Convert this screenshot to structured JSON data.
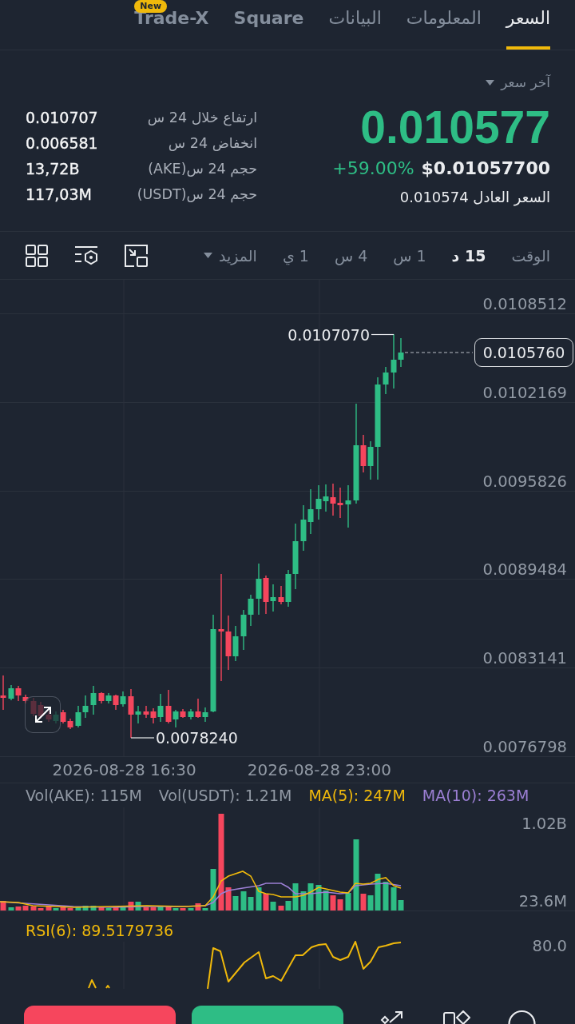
{
  "tabs": [
    {
      "label": "السعر",
      "selected": true
    },
    {
      "label": "المعلومات",
      "selected": false
    },
    {
      "label": "البيانات",
      "selected": false
    },
    {
      "label": "Square",
      "selected": false
    },
    {
      "label": "Trade-X",
      "selected": false,
      "badge": "New"
    }
  ],
  "price": {
    "selector": "آخر سعر",
    "last": "0.010577",
    "usd": "$0.01057700",
    "change": "+59.00%",
    "fair": "السعر العادل 0.010574"
  },
  "stats": [
    {
      "label": "ارتفاع خلال 24 س",
      "value": "0.010707"
    },
    {
      "label": "انخفاض 24 س",
      "value": "0.006581"
    },
    {
      "label": "حجم 24 س(AKE)",
      "value": "13,72B"
    },
    {
      "label": "حجم 24 س(USDT)",
      "value": "117,03M"
    }
  ],
  "toolbar": {
    "label": "الوقت",
    "intervals": [
      {
        "label": "15 د",
        "selected": true
      },
      {
        "label": "1 س",
        "selected": false
      },
      {
        "label": "4 س",
        "selected": false
      },
      {
        "label": "1 ي",
        "selected": false
      }
    ],
    "more": "المزيد"
  },
  "chart": {
    "price_labels": [
      "0.0108512",
      "0.0102169",
      "0.0095826",
      "0.0089484",
      "0.0083141",
      "0.0076798"
    ],
    "high": "0.0107070",
    "low": "0.0078240",
    "current": "0.0105760",
    "time_labels": [
      "2026-08-28 23:00",
      "2026-08-28 16:30"
    ]
  },
  "volume": {
    "legend": [
      {
        "text": "MA(10): 263M",
        "color": "#9c7fd4"
      },
      {
        "text": "MA(5): 247M",
        "color": "#f0b90b"
      },
      {
        "text": "Vol(USDT): 1.21M",
        "color": "#929aa5"
      },
      {
        "text": "Vol(AKE): 115M",
        "color": "#929aa5"
      }
    ],
    "axis_labels": [
      "1.02B",
      "23.6M"
    ]
  },
  "rsi": {
    "legend": "RSI(6): 89.5179736",
    "axis_label": "80.0"
  }
}
